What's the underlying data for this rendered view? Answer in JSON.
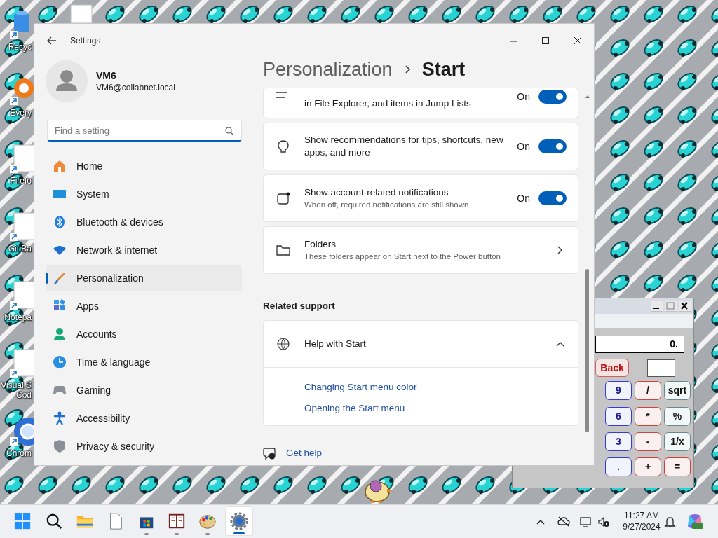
{
  "desktop": {
    "icons": [
      {
        "label": [
          "Recyc"
        ]
      },
      {
        "label": [
          "Every"
        ]
      },
      {
        "label": [
          "Firefo"
        ]
      },
      {
        "label": [
          "Git Ba"
        ]
      },
      {
        "label": [
          "Notepa"
        ]
      },
      {
        "label": [
          "Visual S",
          "Cod"
        ]
      },
      {
        "label": [
          "Chrom"
        ]
      }
    ]
  },
  "calculator": {
    "display": "0.",
    "buttons": [
      {
        "label": "Back",
        "kind": "back"
      },
      {
        "kind": "memory"
      },
      {
        "label": "9",
        "kind": "digit"
      },
      {
        "label": "/",
        "kind": "operator"
      },
      {
        "label": "sqrt",
        "kind": "function"
      },
      {
        "label": "6",
        "kind": "digit"
      },
      {
        "label": "*",
        "kind": "operator"
      },
      {
        "label": "%",
        "kind": "function"
      },
      {
        "label": "3",
        "kind": "digit"
      },
      {
        "label": "-",
        "kind": "operator"
      },
      {
        "label": "1/x",
        "kind": "function"
      },
      {
        "label": ".",
        "kind": "digit"
      },
      {
        "label": "+",
        "kind": "operator"
      },
      {
        "label": "=",
        "kind": "operator"
      }
    ]
  },
  "settings": {
    "window": {
      "title": "Settings"
    },
    "user": {
      "name": "VM6",
      "email": "VM6@collabnet.local"
    },
    "search": {
      "placeholder": "Find a setting"
    },
    "nav": [
      {
        "label": "Home",
        "selected": false
      },
      {
        "label": "System",
        "selected": false
      },
      {
        "label": "Bluetooth & devices",
        "selected": false
      },
      {
        "label": "Network & internet",
        "selected": false
      },
      {
        "label": "Personalization",
        "selected": true
      },
      {
        "label": "Apps",
        "selected": false
      },
      {
        "label": "Accounts",
        "selected": false
      },
      {
        "label": "Time & language",
        "selected": false
      },
      {
        "label": "Gaming",
        "selected": false
      },
      {
        "label": "Accessibility",
        "selected": false
      },
      {
        "label": "Privacy & security",
        "selected": false
      }
    ],
    "breadcrumb": [
      "Personalization",
      "Start"
    ],
    "cards": [
      {
        "kind": "toggle",
        "title": "in File Explorer, and items in Jump Lists",
        "state": "On",
        "on": true
      },
      {
        "kind": "toggle",
        "title": "Show recommendations for tips, shortcuts, new apps, and more",
        "state": "On",
        "on": true
      },
      {
        "kind": "toggle",
        "title": "Show account-related notifications",
        "subtitle": "When off, required notifications are still shown",
        "state": "On",
        "on": true
      },
      {
        "kind": "link",
        "title": "Folders",
        "subtitle": "These folders appear on Start next to the Power button"
      }
    ],
    "related_support": {
      "heading": "Related support",
      "help": {
        "title": "Help with Start",
        "expanded": true,
        "links": [
          "Changing Start menu color",
          "Opening the Start menu"
        ]
      }
    },
    "get_help": "Get help"
  },
  "taskbar": {
    "apps": [
      {
        "running": false,
        "active": false
      },
      {
        "running": false,
        "active": false
      },
      {
        "running": false,
        "active": false
      },
      {
        "running": false,
        "active": false
      },
      {
        "running": true,
        "active": false
      },
      {
        "running": true,
        "active": false
      },
      {
        "running": true,
        "active": false
      },
      {
        "running": true,
        "active": true
      }
    ],
    "clock": {
      "time": "11:27 AM",
      "date": "9/27/2024"
    }
  }
}
